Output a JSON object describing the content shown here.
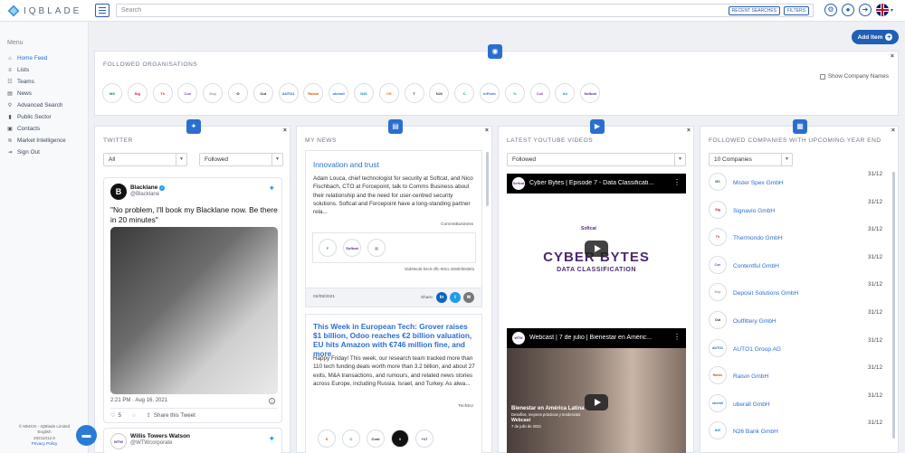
{
  "app": {
    "logo_text": "IQBLADE"
  },
  "search": {
    "placeholder": "Search",
    "recent_label": "RECENT SEARCHES",
    "filters_label": "FILTERS"
  },
  "sidebar": {
    "title": "Menu",
    "items": [
      {
        "label": "Home Feed",
        "icon": "home-icon"
      },
      {
        "label": "Lists",
        "icon": "list-icon"
      },
      {
        "label": "Teams",
        "icon": "teams-icon"
      },
      {
        "label": "News",
        "icon": "news-icon"
      },
      {
        "label": "Advanced Search",
        "icon": "search-icon"
      },
      {
        "label": "Public Sector",
        "icon": "building-icon"
      },
      {
        "label": "Contacts",
        "icon": "contacts-icon"
      },
      {
        "label": "Market Intelligence",
        "icon": "intelligence-icon"
      },
      {
        "label": "Sign Out",
        "icon": "sign-out-icon"
      }
    ],
    "footer": [
      "© MMXXI - IQBlade Limited",
      "English",
      "20211012.6",
      "Privacy Policy"
    ]
  },
  "add_item": {
    "label": "Add Item"
  },
  "followed_orgs": {
    "title": "FOLLOWED ORGANISATIONS",
    "show_names_label": "Show Company Names",
    "logos": [
      "MS",
      "Sig",
      "Th",
      "Con",
      "Dep",
      "O",
      "Out",
      "AUTO1",
      "Raisin",
      "uberall",
      "N26",
      "OR",
      "T",
      "N26",
      "C",
      "InForm",
      "%",
      "Coll",
      "Air",
      "Softcat"
    ]
  },
  "twitter": {
    "title": "TWITTER",
    "filter_value": "All",
    "mode_value": "Followed",
    "tweet": {
      "name": "Blacklane",
      "handle": "@Blacklane",
      "text": "\"No problem, I'll book my Blacklane now. Be there in 20 minutes\"",
      "datetime": "2:21 PM · Aug 16, 2021",
      "likes": "5",
      "share_label": "Share this Tweet"
    },
    "tweet2": {
      "name": "Willis Towers Watson",
      "handle": "@WTWcorporate"
    }
  },
  "my_news": {
    "title": "MY NEWS",
    "articles": [
      {
        "headline": "Innovation and trust",
        "body": "Adam Louca, chief technologist for security at Softcat, and Nico Fischbach, CTO at Forcepoint, talk to Comms Business about their relationship and the need for user-centred security solutions. Softcat and Forcepoint have a long-standing partner rela...",
        "source": "CommsBusiness",
        "id": "5bd89ed5-b6c9-4ffc-9061-2869bf59d6fa",
        "date": "02/08/2021",
        "share_label": "Share:"
      },
      {
        "headline": "This Week in European Tech: Grover raises $1 billion, Odoo reaches €2 billion valuation, EU hits Amazon with €746 million fine, and more",
        "body": "Happy Friday! This week, our research team tracked more than 110 tech funding deals worth more than 3.2 billion, and about 27 exits, M&A transactions, and rumours, and related news stories across Europe, including Russia, Israel, and Turkey. As alwa...",
        "source": "TechEU",
        "more_count": "+17"
      }
    ]
  },
  "youtube": {
    "title": "LATEST YOUTUBE VIDEOS",
    "mode_value": "Followed",
    "videos": [
      {
        "title": "Cyber Bytes | Episode 7 - Data Classificati...",
        "slide_small": "Softcat",
        "slide_big": "CYBER BYTES",
        "slide_sub": "DATA CLASSIFICATION"
      },
      {
        "title": "Webcast | 7 de julio | Bienestar en Améric...",
        "caption_title": "Bienestar en América Latina",
        "caption_sub": "Desafíos, mejores prácticas y tendencias",
        "caption_webcast": "Webcast",
        "caption_date": "7 de julio de 2021"
      }
    ]
  },
  "upcoming": {
    "title": "FOLLOWED COMPANIES WITH UPCOMING YEAR END",
    "count_value": "10 Companies",
    "companies": [
      {
        "name": "Mister Spex GmbH",
        "date": "31/12",
        "logo": "MS"
      },
      {
        "name": "Signavio GmbH",
        "date": "31/12",
        "logo": "Sig"
      },
      {
        "name": "Thermondo GmbH",
        "date": "31/12",
        "logo": "Th"
      },
      {
        "name": "Contentful GmbH",
        "date": "31/12",
        "logo": "Con"
      },
      {
        "name": "Deposit Solutions GmbH",
        "date": "31/12",
        "logo": "Dep"
      },
      {
        "name": "Outfittery GmbH",
        "date": "31/12",
        "logo": "Out"
      },
      {
        "name": "AUTO1 Group AG",
        "date": "31/12",
        "logo": "AUTO1"
      },
      {
        "name": "Raisin GmbH",
        "date": "31/12",
        "logo": "Raisin"
      },
      {
        "name": "uberall GmbH",
        "date": "31/12",
        "logo": "uberall"
      },
      {
        "name": "N26 Bank GmbH",
        "date": "31/12",
        "logo": "N26"
      }
    ]
  }
}
